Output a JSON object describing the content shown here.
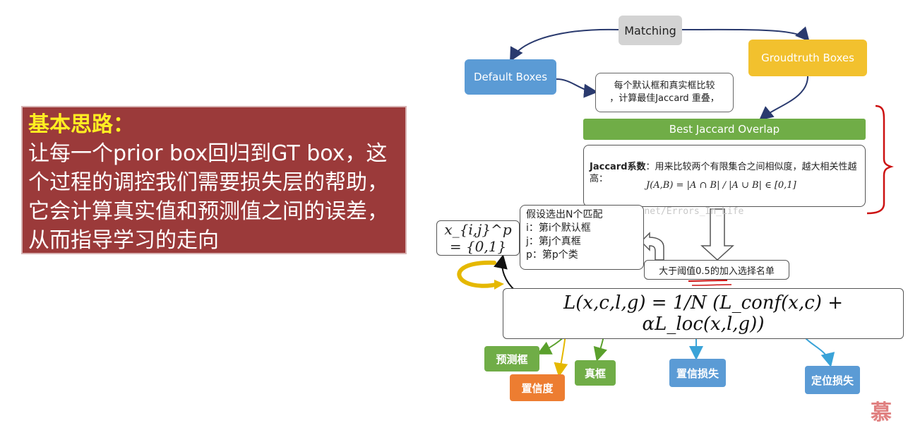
{
  "left_panel": {
    "title": "基本思路：",
    "body": "让每一个prior box回归到GT box，这个过程的调控我们需要损失层的帮助，它会计算真实值和预测值之间的误差，从而指导学习的走向"
  },
  "diagram": {
    "matching": "Matching",
    "default_boxes": "Default Boxes",
    "groundtruth_boxes": "Groudtruth Boxes",
    "compare_note_line1": "每个默认框和真实框比较",
    "compare_note_line2": "，计算最佳Jaccard 重叠，",
    "best_overlap": "Best Jaccard Overlap",
    "jaccard_label": "Jaccard系数",
    "jaccard_desc": "：用来比较两个有限集合之间相似度，越大相关性越高：",
    "jaccard_formula": "J(A,B) = |A ∩ B| / |A ∪ B| ∈ [0,1]",
    "xijp": "x_{i,j}^p = {0,1}",
    "choose_title": "假设选出N个匹配",
    "choose_i": "i：第i个默认框",
    "choose_j": "j：第j个真框",
    "choose_p": "p：第p个类",
    "threshold": "大于阈值0.5的加入选择名单",
    "watermark": "log.csdn.net/Errors_In_Life",
    "loss_formula": "L(x,c,l,g) = 1/N (L_conf(x,c) + αL_loc(x,l,g))",
    "tags": {
      "pred": "预测框",
      "conf": "置信度",
      "gt": "真框",
      "conf_loss": "置信损失",
      "loc_loss": "定位损失"
    },
    "brand": "慕"
  },
  "colors": {
    "panel_bg": "#9b3a3a",
    "panel_title": "#ffee22",
    "blue": "#5b9bd5",
    "yellow": "#f2c12e",
    "green": "#70ad47",
    "orange": "#ed7d31",
    "annotation_red": "#cc1111"
  }
}
